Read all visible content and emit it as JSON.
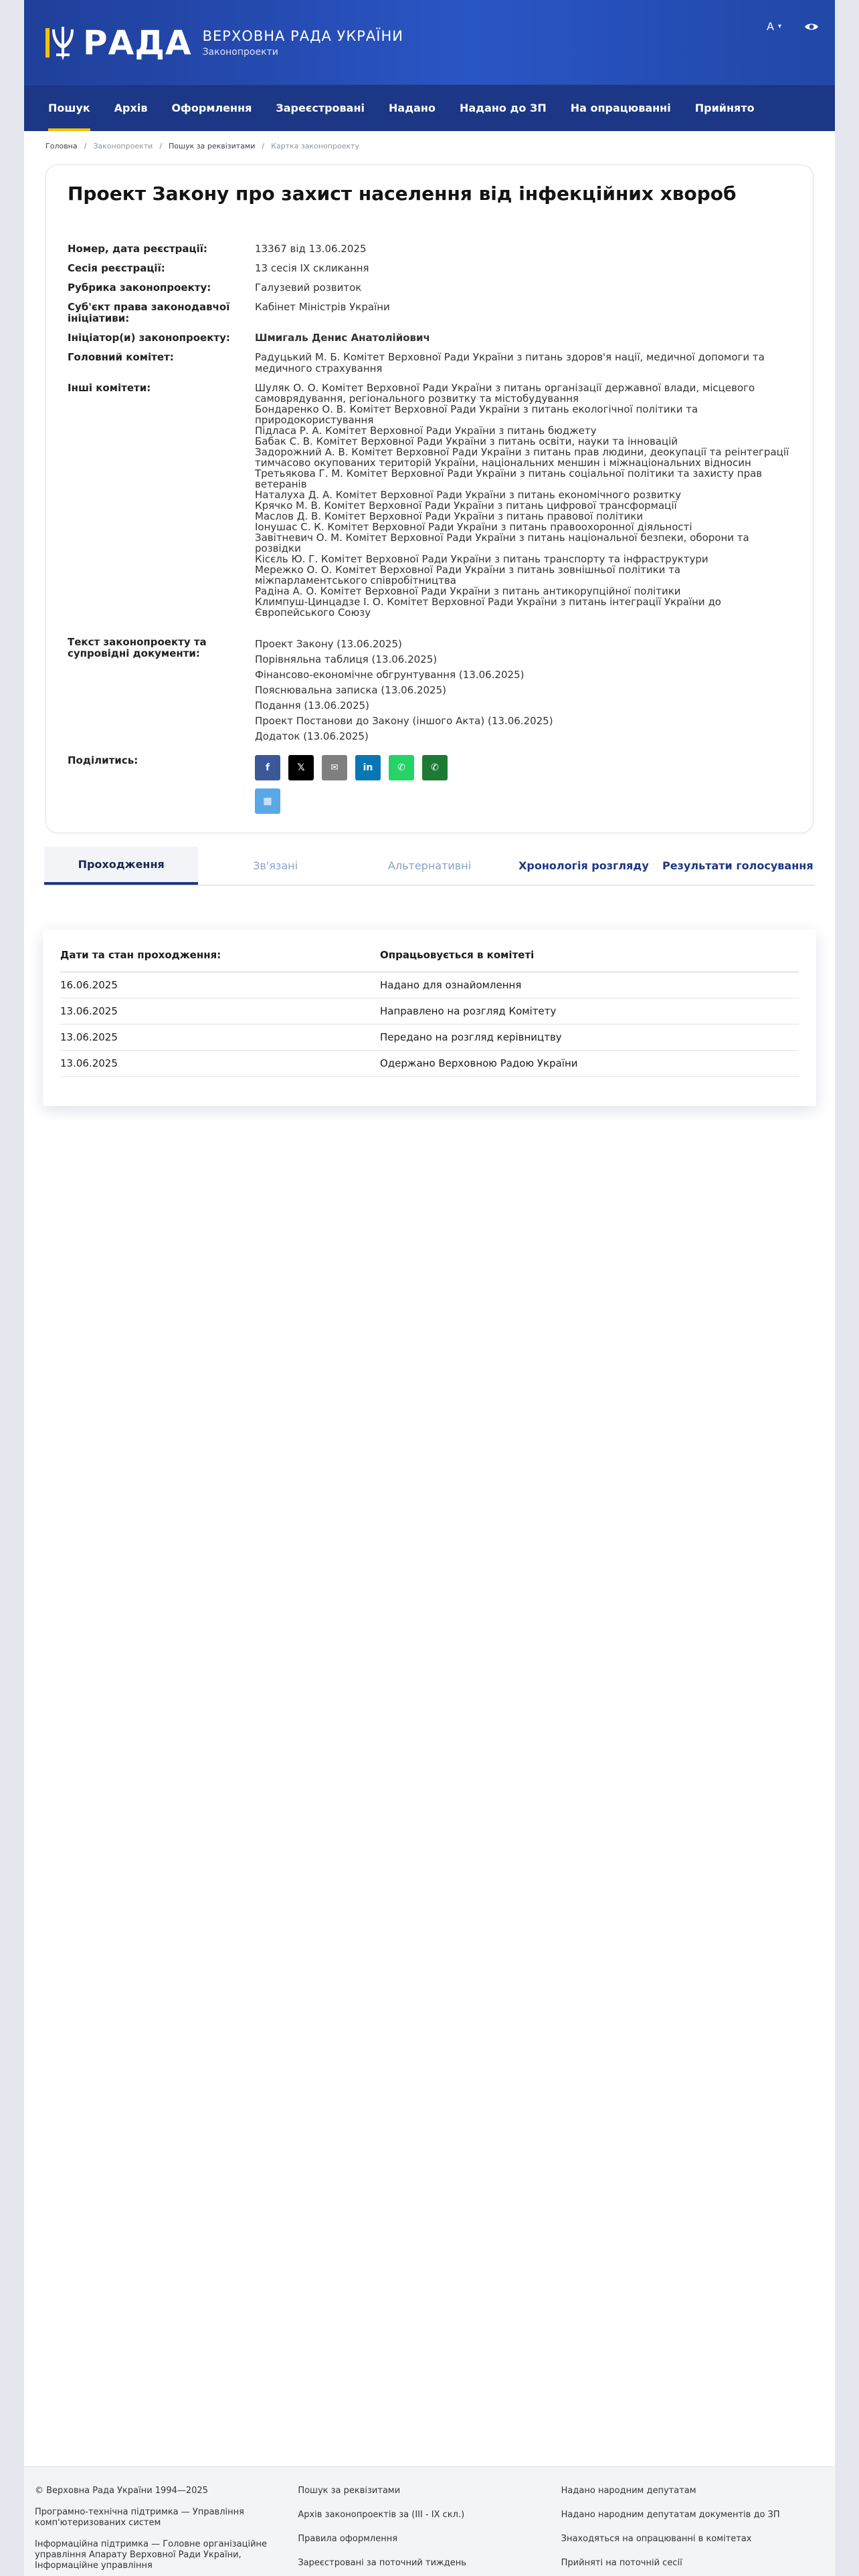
{
  "header": {
    "logo_word": "РАДА",
    "title": "ВЕРХОВНА РАДА УКРАЇНИ",
    "subtitle": "Законопроекти",
    "font_switch": "A",
    "brand_blue": "#1f3f9a",
    "accent_yellow": "#f5c400"
  },
  "nav": [
    {
      "label": "Пошук",
      "active": true
    },
    {
      "label": "Архів"
    },
    {
      "label": "Оформлення"
    },
    {
      "label": "Зареєстровані"
    },
    {
      "label": "Надано"
    },
    {
      "label": "Надано до ЗП"
    },
    {
      "label": "На опрацюванні"
    },
    {
      "label": "Прийнято"
    }
  ],
  "breadcrumbs": [
    "Головна",
    "Законопроекти",
    "Пошук за реквізитами",
    "Картка законопроекту"
  ],
  "bill": {
    "title": "Проект Закону про захист населення від інфекційних хвороб",
    "fields": [
      {
        "label": "Номер, дата реєстрації:",
        "value": "13367 від 13.06.2025"
      },
      {
        "label": "Сесія реєстрації:",
        "value": "13 сесія IX скликання"
      },
      {
        "label": "Рубрика законопроекту:",
        "value": "Галузевий розвиток"
      },
      {
        "label": "Суб'єкт права законодавчої ініціативи:",
        "value": "Кабінет Міністрів України"
      },
      {
        "label": "Ініціатор(и) законопроекту:",
        "value": "Шмигаль Денис Анатолійович"
      },
      {
        "label": "Головний комітет:",
        "value": "Радуцький М. Б. Комітет Верховної Ради України з питань здоров'я нації, медичної допомоги та медичного страхування"
      }
    ],
    "other_committees_label": "Інші комітети:",
    "other_committees": [
      "Шуляк О. О. Комітет Верховної Ради України з питань організації державної влади, місцевого самоврядування, регіонального розвитку та містобудування",
      "Бондаренко О. В. Комітет Верховної Ради України з питань екологічної політики та природокористування",
      "Підласа Р. А. Комітет Верховної Ради України з питань бюджету",
      "Бабак С. В. Комітет Верховної Ради України з питань освіти, науки та інновацій",
      "Задорожний А. В. Комітет Верховної Ради України з питань прав людини, деокупації та реінтеграції тимчасово окупованих територій України, національних меншин і міжнаціональних відносин",
      "Третьякова Г. М. Комітет Верховної Ради України з питань соціальної політики та захисту прав ветеранів",
      "Наталуха Д. А. Комітет Верховної Ради України з питань економічного розвитку",
      "Крячко М. В. Комітет Верховної Ради України з питань цифрової трансформації",
      "Маслов Д. В. Комітет Верховної Ради України з питань правової політики",
      "Іонушас С. К. Комітет Верховної Ради України з питань правоохоронної діяльності",
      "Завітневич О. М. Комітет Верховної Ради України з питань національної безпеки, оборони та розвідки",
      "Кісєль Ю. Г. Комітет Верховної Ради України з питань транспорту та інфраструктури",
      "Мережко О. О. Комітет Верховної Ради України з питань зовнішньої політики та міжпарламентського співробітництва",
      "Радіна А. О. Комітет Верховної Ради України з питань антикорупційної політики",
      "Климпуш-Цинцадзе І. О. Комітет Верховної Ради України з питань інтеграції України до Європейського Союзу"
    ],
    "docs_label": "Текст законопроекту та супровідні документи:",
    "docs": [
      "Проект Закону (13.06.2025)",
      "Порівняльна таблиця (13.06.2025)",
      "Фінансово-економічне обгрунтування (13.06.2025)",
      "Пояснювальна записка (13.06.2025)",
      "Подання (13.06.2025)",
      "Проект Постанови до Закону (іншого Акта) (13.06.2025)",
      "Додаток (13.06.2025)"
    ],
    "share_label": "Поділитись:",
    "share": [
      {
        "icon": "facebook-icon",
        "glyph": "f",
        "color": "#3b5998"
      },
      {
        "icon": "x-icon",
        "glyph": "𝕏",
        "color": "#000000"
      },
      {
        "icon": "email-icon",
        "glyph": "✉",
        "color": "#7f7f7f"
      },
      {
        "icon": "linkedin-icon",
        "glyph": "in",
        "color": "#0a77b5"
      },
      {
        "icon": "whatsapp-icon",
        "glyph": "✆",
        "color": "#25d366"
      },
      {
        "icon": "viber-icon",
        "glyph": "✆",
        "color": "#1d7a34"
      },
      {
        "icon": "qr-code-icon",
        "glyph": "▦",
        "color": "#5aa9e6"
      }
    ]
  },
  "tabs": [
    {
      "label": "Проходження",
      "active": true
    },
    {
      "label": "Зв'язані"
    },
    {
      "label": "Альтернативні"
    },
    {
      "label": "Хронологія розгляду",
      "strong": true
    },
    {
      "label": "Результати голосування",
      "strong": true
    }
  ],
  "history": {
    "col_date": "Дати та стан проходження:",
    "col_committee": "Опрацьовується в комітеті",
    "rows": [
      {
        "date": "16.06.2025",
        "status": "Надано для ознайомлення"
      },
      {
        "date": "13.06.2025",
        "status": "Направлено на розгляд Комітету"
      },
      {
        "date": "13.06.2025",
        "status": "Передано на розгляд керівництву"
      },
      {
        "date": "13.06.2025",
        "status": "Одержано Верховною Радою України"
      }
    ]
  },
  "footer": {
    "col1": [
      "© Верховна Рада України 1994—2025",
      "Програмно-технічна підтримка — Управління комп'ютеризованих систем",
      "Інформаційна підтримка — Головне організаційне управління Апарату Верховної Ради України, Інформаційне управління"
    ],
    "col2": [
      "Пошук за реквізитами",
      "Архів законопроектів за (III - IX скл.)",
      "Правила оформлення",
      "Зареєстровані за поточний тиждень"
    ],
    "col3": [
      "Надано народним депутатам",
      "Надано народним депутатам документів до ЗП",
      "Знаходяться на опрацюванні в комітетах",
      "Прийняті на поточній сесії"
    ]
  }
}
